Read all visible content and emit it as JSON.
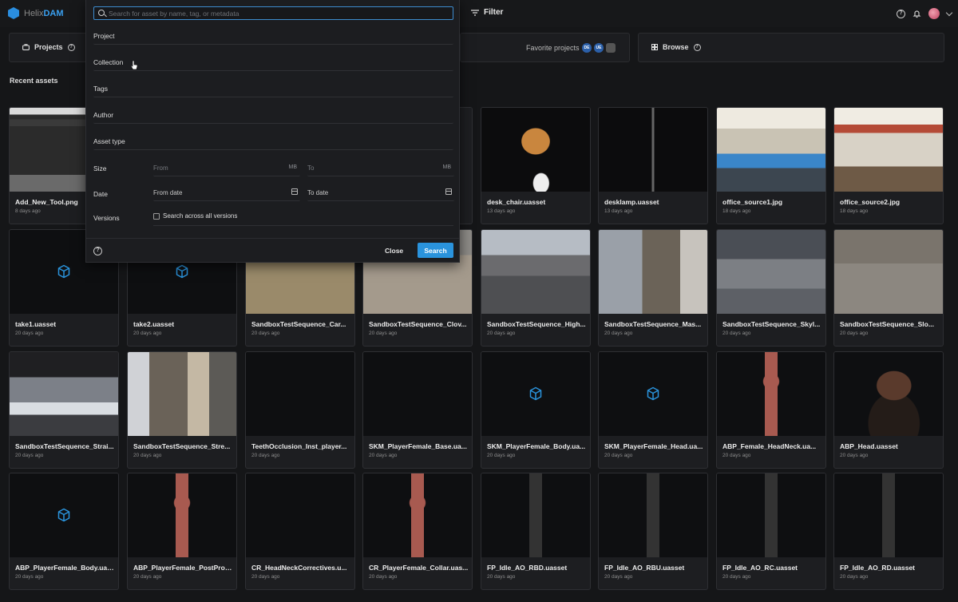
{
  "app": {
    "brand_prefix": "Helix",
    "brand_suffix": "DAM"
  },
  "topbar": {
    "filter_label": "Filter",
    "help_icon": "question-circle-icon",
    "notify_icon": "bell-icon"
  },
  "nav": {
    "projects_label": "Projects",
    "favorites_label": "Favorite projects",
    "favorite_badges": [
      "DE",
      "UE",
      ""
    ],
    "browse_label": "Browse"
  },
  "recent_assets_label": "Recent assets",
  "search": {
    "placeholder": "Search for asset by name, tag, or metadata",
    "fields": [
      "Project",
      "Collection",
      "Tags",
      "Author",
      "Asset type"
    ],
    "size_label": "Size",
    "size_from_placeholder": "From",
    "size_to_placeholder": "To",
    "size_unit": "MB",
    "date_label": "Date",
    "date_from_placeholder": "From date",
    "date_to_placeholder": "To date",
    "versions_label": "Versions",
    "versions_checkbox_label": "Search across all versions",
    "versions_checked": false,
    "close_label": "Close",
    "search_label": "Search"
  },
  "assets": [
    {
      "name": "Add_New_Tool.png",
      "date": "8 days ago",
      "thumb": "tool-screenshot"
    },
    {
      "name": "",
      "date": "",
      "thumb": "hidden"
    },
    {
      "name": "",
      "date": "",
      "thumb": "hidden"
    },
    {
      "name": "",
      "date": "",
      "thumb": "hidden"
    },
    {
      "name": "desk_chair.uasset",
      "date": "13 days ago",
      "thumb": "chair"
    },
    {
      "name": "desklamp.uasset",
      "date": "13 days ago",
      "thumb": "lamp"
    },
    {
      "name": "office_source1.jpg",
      "date": "18 days ago",
      "thumb": "office1"
    },
    {
      "name": "office_source2.jpg",
      "date": "18 days ago",
      "thumb": "office2"
    },
    {
      "name": "take1.uasset",
      "date": "20 days ago",
      "thumb": "cube"
    },
    {
      "name": "take2.uasset",
      "date": "20 days ago",
      "thumb": "cube"
    },
    {
      "name": "SandboxTestSequence_Car...",
      "date": "20 days ago",
      "thumb": "city-a"
    },
    {
      "name": "SandboxTestSequence_Clov...",
      "date": "20 days ago",
      "thumb": "city-b"
    },
    {
      "name": "SandboxTestSequence_High...",
      "date": "20 days ago",
      "thumb": "city-c"
    },
    {
      "name": "SandboxTestSequence_Mas...",
      "date": "20 days ago",
      "thumb": "city-d"
    },
    {
      "name": "SandboxTestSequence_Skyl...",
      "date": "20 days ago",
      "thumb": "city-e"
    },
    {
      "name": "SandboxTestSequence_Slo...",
      "date": "20 days ago",
      "thumb": "city-f"
    },
    {
      "name": "SandboxTestSequence_Strai...",
      "date": "20 days ago",
      "thumb": "city-g"
    },
    {
      "name": "SandboxTestSequence_Stre...",
      "date": "20 days ago",
      "thumb": "city-h"
    },
    {
      "name": "TeethOcclusion_Inst_player...",
      "date": "20 days ago",
      "thumb": "dark"
    },
    {
      "name": "SKM_PlayerFemale_Base.ua...",
      "date": "20 days ago",
      "thumb": "dark"
    },
    {
      "name": "SKM_PlayerFemale_Body.ua...",
      "date": "20 days ago",
      "thumb": "cube"
    },
    {
      "name": "SKM_PlayerFemale_Head.ua...",
      "date": "20 days ago",
      "thumb": "cube"
    },
    {
      "name": "ABP_Female_HeadNeck.ua...",
      "date": "20 days ago",
      "thumb": "mannequin-red"
    },
    {
      "name": "ABP_Head.uasset",
      "date": "20 days ago",
      "thumb": "head"
    },
    {
      "name": "ABP_PlayerFemale_Body.uas...",
      "date": "20 days ago",
      "thumb": "cube"
    },
    {
      "name": "ABP_PlayerFemale_PostProc...",
      "date": "20 days ago",
      "thumb": "mannequin-red"
    },
    {
      "name": "CR_HeadNeckCorrectives.u...",
      "date": "20 days ago",
      "thumb": "dark"
    },
    {
      "name": "CR_PlayerFemale_Collar.uas...",
      "date": "20 days ago",
      "thumb": "mannequin-red"
    },
    {
      "name": "FP_Idle_AO_RBD.uasset",
      "date": "20 days ago",
      "thumb": "figure-dark"
    },
    {
      "name": "FP_Idle_AO_RBU.uasset",
      "date": "20 days ago",
      "thumb": "figure-dark"
    },
    {
      "name": "FP_Idle_AO_RC.uasset",
      "date": "20 days ago",
      "thumb": "figure-dark"
    },
    {
      "name": "FP_Idle_AO_RD.uasset",
      "date": "20 days ago",
      "thumb": "figure-dark"
    }
  ],
  "colors": {
    "accent": "#2a93dc",
    "background": "#151618",
    "card": "#1d1e21"
  }
}
